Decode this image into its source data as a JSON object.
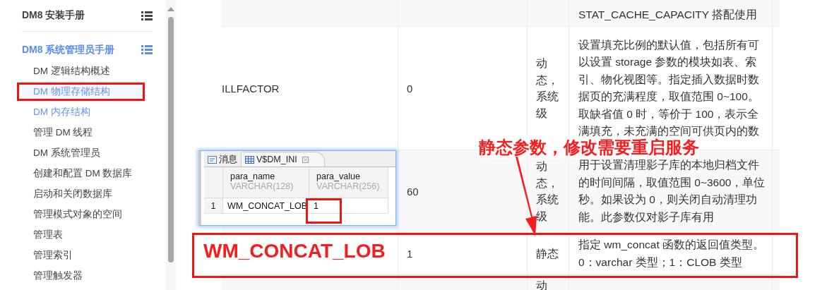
{
  "sidebar": {
    "sections": [
      {
        "title": "DM8 安装手册",
        "selected": false
      },
      {
        "title": "DM8 系统管理员手册",
        "selected": true,
        "items": [
          {
            "label": "DM 逻辑结构概述",
            "selected": false,
            "active": false
          },
          {
            "label": "DM 物理存储结构",
            "selected": true,
            "active": true
          },
          {
            "label": "DM 内存结构",
            "selected": false,
            "active": true
          },
          {
            "label": "管理 DM 线程",
            "selected": false,
            "active": false
          },
          {
            "label": "DM 系统管理员",
            "selected": false,
            "active": false
          },
          {
            "label": "创建和配置 DM 数据库",
            "selected": false,
            "active": false
          },
          {
            "label": "启动和关闭数据库",
            "selected": false,
            "active": false
          },
          {
            "label": "管理模式对象的空间",
            "selected": false,
            "active": false
          },
          {
            "label": "管理表",
            "selected": false,
            "active": false
          },
          {
            "label": "管理索引",
            "selected": false,
            "active": false
          },
          {
            "label": "管理触发器",
            "selected": false,
            "active": false
          }
        ]
      }
    ]
  },
  "table": {
    "rows": [
      {
        "name": "",
        "value": "",
        "attribute": "",
        "description": "STAT_CACHE_CAPACITY 搭配使用"
      },
      {
        "name": "ILLFACTOR",
        "value": "0",
        "attribute": "动态，系统级",
        "description": "设置填充比例的默认值，包括所有可以设置 storage 参数的模块如表、索引、物化视图等。指定插入数据时数据页的充满程度，取值范围 0~100。取缺省值 0 时，等价于 100，表示全满填充，未充满的空间可供页内的数"
      },
      {
        "name": "",
        "value": "60",
        "attribute": "动态，系统级",
        "description": "用于设置清理影子库的本地归档文件的时间间隔，取值范围 0~3600，单位秒。如果设为 0，则关闭自动清理功能。此参数仅对影子库有用"
      },
      {
        "name": "",
        "value": "1",
        "attribute": "静态",
        "description": "指定 wm_concat 函数的返回值类型。0：varchar 类型；1：CLOB 类型"
      },
      {
        "name": "",
        "value": "",
        "attribute": "动",
        "description": ""
      }
    ]
  },
  "result_panel": {
    "tabs": [
      {
        "label": "消息",
        "selected": false
      },
      {
        "label": "V$DM_INI",
        "selected": true
      }
    ],
    "columns": [
      {
        "name": "para_name",
        "type": "VARCHAR(128)"
      },
      {
        "name": "para_value",
        "type": "VARCHAR(256)"
      }
    ],
    "rows": [
      {
        "index": "1",
        "cells": [
          "WM_CONCAT_LOB",
          "1"
        ]
      }
    ]
  },
  "annotations": [
    {
      "kind": "callout",
      "text": "静态参数，修改需要重启服务"
    },
    {
      "kind": "label",
      "text": "WM_CONCAT_LOB"
    }
  ]
}
